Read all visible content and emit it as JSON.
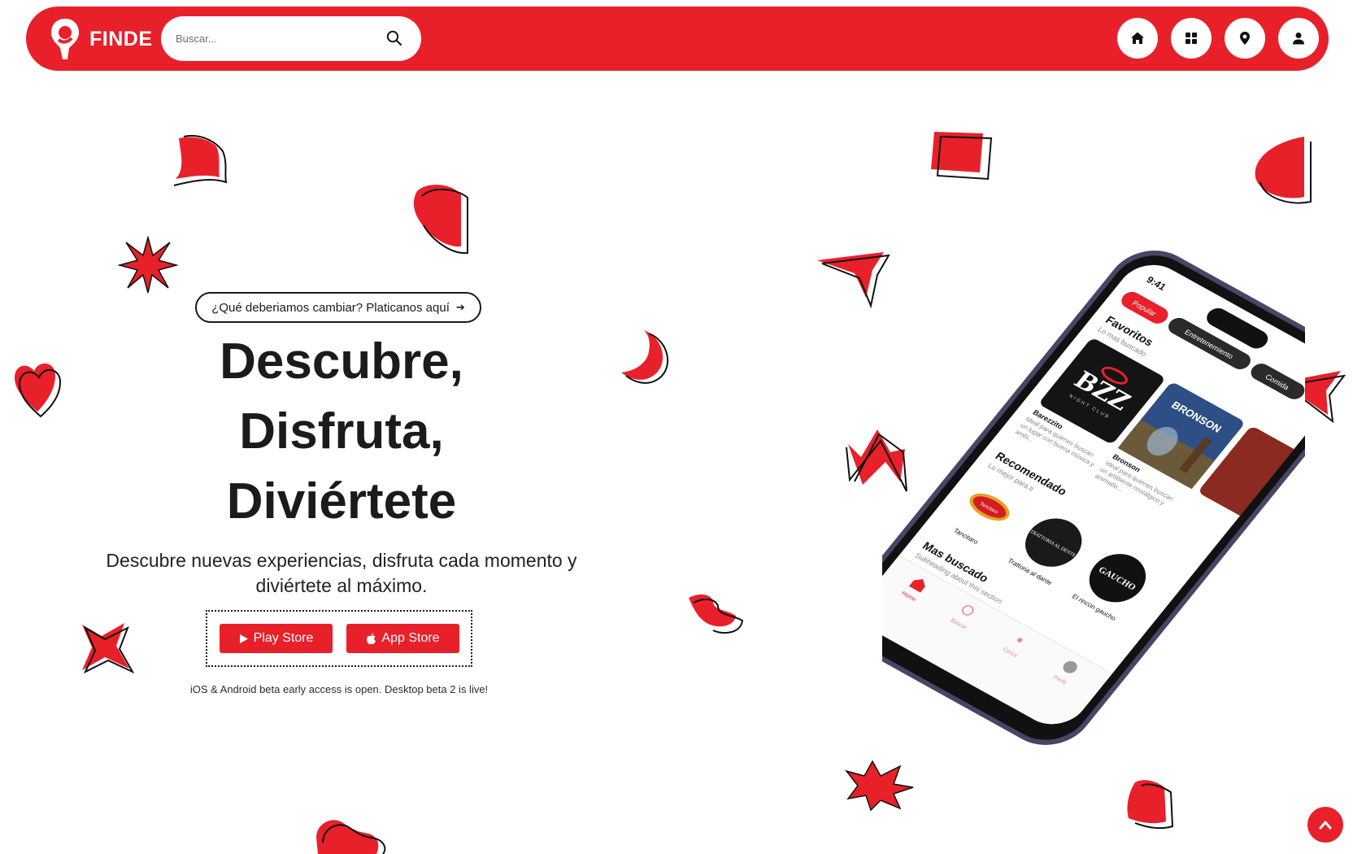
{
  "brand": {
    "name": "FINDE"
  },
  "search": {
    "placeholder": "Buscar..."
  },
  "nav": {
    "icons": [
      "home-icon",
      "grid-icon",
      "location-pin-icon",
      "user-icon"
    ]
  },
  "hero": {
    "feedback_label": "¿Qué deberiamos cambiar? Platicanos aquí",
    "headline": [
      "Descubre,",
      "Disfruta,",
      "Diviértete"
    ],
    "subhead": "Descubre nuevas experiencias, disfruta cada momento y diviértete al máximo.",
    "play_store_label": "Play Store",
    "app_store_label": "App Store",
    "beta_note": "iOS & Android beta early access is open. Desktop beta 2 is live!"
  },
  "phone": {
    "time": "9:41",
    "chips": [
      "Popular",
      "Entretenemiento",
      "Comida"
    ],
    "favorites": {
      "title": "Favoritos",
      "subtitle": "Lo mas buscado",
      "cards": [
        {
          "name": "Barezzito",
          "desc": "Ideal para quienes buscan un lugar con buena música y ambi...",
          "logo": "BZZ",
          "logo_sub": "NIGHT CLUB"
        },
        {
          "name": "Bronson",
          "desc": "Ideal para quienes buscan un ambiente nostálgico y animado...",
          "logo": "BRONSON"
        }
      ]
    },
    "recommended": {
      "title": "Recomendado",
      "subtitle": "Lo mejor para ti",
      "items": [
        {
          "name": "Tancitaro",
          "logo": "Tancitaro"
        },
        {
          "name": "Trattoria al dante",
          "logo": "TRATTORIA AL DENTE"
        },
        {
          "name": "El rincon gaucho",
          "logo": "GAUCHO"
        }
      ]
    },
    "most_searched": {
      "title": "Mas buscado",
      "subtitle": "Subheading about this section"
    },
    "tabs": [
      "Home",
      "Buscar",
      "Cerca",
      "Perfil"
    ]
  },
  "colors": {
    "accent": "#e8202a",
    "text": "#1b1b1b",
    "phone_frame": "#4a4466"
  }
}
